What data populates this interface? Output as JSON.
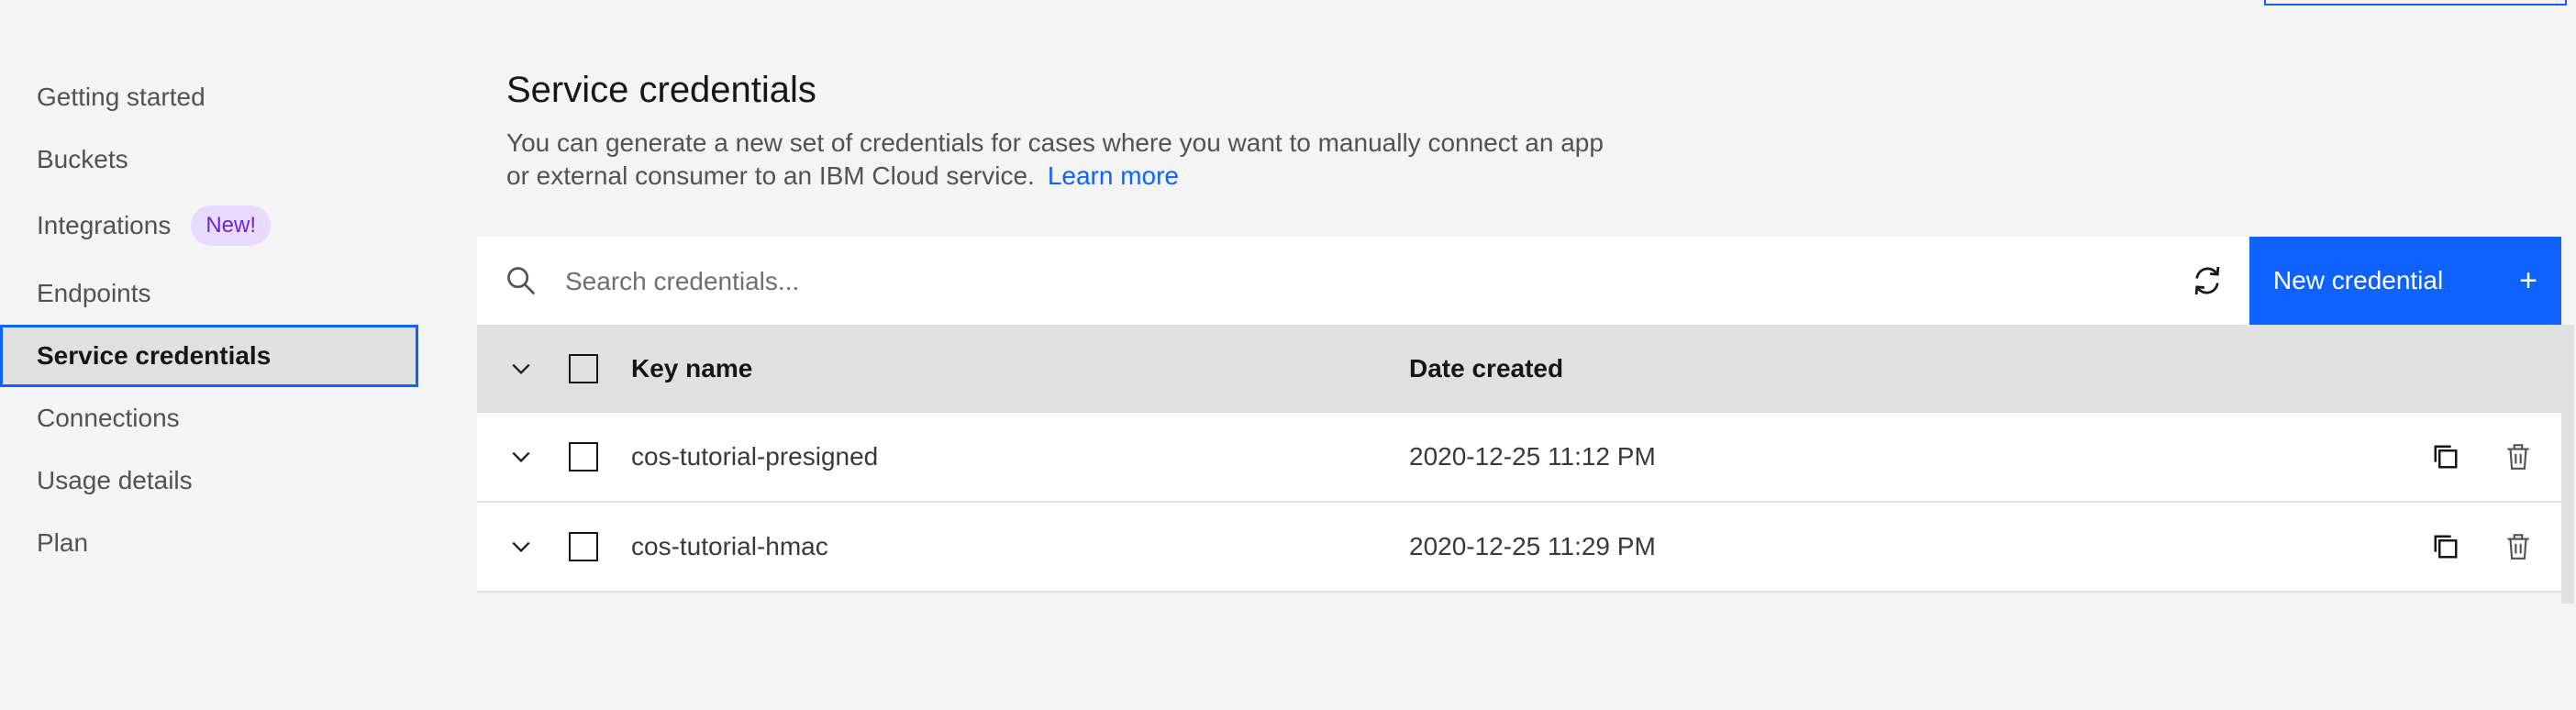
{
  "sidebar": {
    "items": [
      {
        "label": "Getting started"
      },
      {
        "label": "Buckets"
      },
      {
        "label": "Integrations",
        "badge": "New!"
      },
      {
        "label": "Endpoints"
      },
      {
        "label": "Service credentials",
        "active": true
      },
      {
        "label": "Connections"
      },
      {
        "label": "Usage details"
      },
      {
        "label": "Plan"
      }
    ]
  },
  "header": {
    "title": "Service credentials",
    "description": "You can generate a new set of credentials for cases where you want to manually connect an app or external consumer to an IBM Cloud service.",
    "learn_more": "Learn more"
  },
  "toolbar": {
    "search_placeholder": "Search credentials...",
    "refresh_icon": "refresh-icon",
    "new_button_label": "New credential",
    "new_button_icon": "+"
  },
  "table": {
    "columns": [
      "Key name",
      "Date created"
    ],
    "rows": [
      {
        "name": "cos-tutorial-presigned",
        "date": "2020-12-25 11:12 PM"
      },
      {
        "name": "cos-tutorial-hmac",
        "date": "2020-12-25 11:29 PM"
      }
    ]
  },
  "colors": {
    "accent": "#0f62fe",
    "badge_bg": "#e8daff",
    "badge_text": "#6929c4",
    "page_bg": "#f4f4f4"
  }
}
